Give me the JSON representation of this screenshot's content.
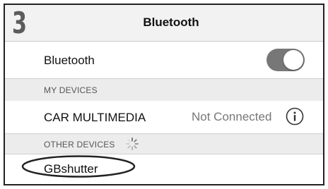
{
  "step_number": "3",
  "nav": {
    "title": "Bluetooth"
  },
  "bluetooth_row": {
    "label": "Bluetooth",
    "toggle_on": true
  },
  "my_devices": {
    "header": "MY DEVICES",
    "devices": [
      {
        "name": "CAR MULTIMEDIA",
        "status": "Not Connected",
        "icon": "info-icon"
      }
    ]
  },
  "other_devices": {
    "header": "OTHER DEVICES",
    "spinner_icon": "loading-spinner-icon",
    "devices": [
      {
        "name": "GBshutter",
        "highlighted": true
      }
    ]
  },
  "colors": {
    "toggle_on": "#777777",
    "section_bg": "#ececec",
    "nav_bg": "#f2f2f2"
  }
}
